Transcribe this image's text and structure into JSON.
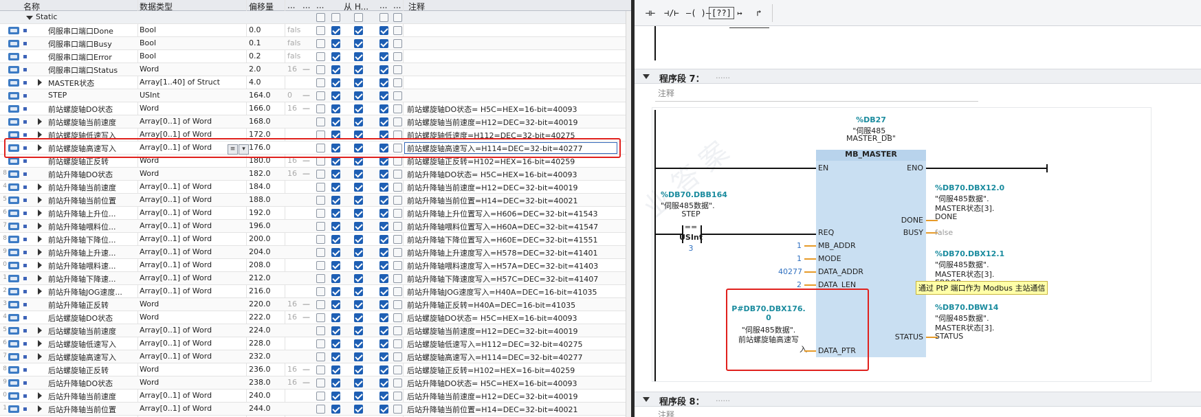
{
  "table": {
    "headers": {
      "name": "名称",
      "datatype": "数据类型",
      "offset": "偏移量",
      "col_a": "...",
      "col_b": "...",
      "col_c": "...",
      "col_d": "从 H...",
      "col_e": "...",
      "col_f": "...",
      "comment": "注释"
    },
    "static_label": "Static",
    "rows": [
      {
        "num": "",
        "name": "伺服串口端口Done",
        "type": "Bool",
        "offset": "0.0",
        "init": "fals",
        "dash": "",
        "expandable": false,
        "comment": ""
      },
      {
        "num": "",
        "name": "伺服串口端口Busy",
        "type": "Bool",
        "offset": "0.1",
        "init": "fals",
        "dash": "",
        "expandable": false,
        "comment": ""
      },
      {
        "num": "",
        "name": "伺服串口端口Error",
        "type": "Bool",
        "offset": "0.2",
        "init": "fals",
        "dash": "",
        "expandable": false,
        "comment": ""
      },
      {
        "num": "",
        "name": "伺服串口端口Status",
        "type": "Word",
        "offset": "2.0",
        "init": "16",
        "dash": "—",
        "expandable": false,
        "comment": ""
      },
      {
        "num": "",
        "name": "MASTER状态",
        "type": "Array[1..40] of Struct",
        "offset": "4.0",
        "init": "",
        "dash": "",
        "expandable": true,
        "comment": ""
      },
      {
        "num": "",
        "name": "STEP",
        "type": "USInt",
        "offset": "164.0",
        "init": "0",
        "dash": "—",
        "expandable": false,
        "comment": ""
      },
      {
        "num": "",
        "name": "前站螺旋轴DO状态",
        "type": "Word",
        "offset": "166.0",
        "init": "16",
        "dash": "—",
        "expandable": false,
        "comment": "前站螺旋轴DO状态= H5C=HEX=16-bit=40093"
      },
      {
        "num": "",
        "name": "前站螺旋轴当前速度",
        "type": "Array[0..1] of Word",
        "offset": "168.0",
        "init": "",
        "dash": "",
        "expandable": true,
        "comment": "前站螺旋轴当前速度=H12=DEC=32-bit=40019"
      },
      {
        "num": "",
        "name": "前站螺旋轴低速写入",
        "type": "Array[0..1] of Word",
        "offset": "172.0",
        "init": "",
        "dash": "",
        "expandable": true,
        "comment": "前站螺旋轴低速度=H112=DEC=32-bit=40275"
      },
      {
        "num": "",
        "name": "前站螺旋轴高速写入",
        "type": "Array[0..1] of Word",
        "offset": "176.0",
        "init": "",
        "dash": "",
        "expandable": true,
        "comment": "前站螺旋轴高速写入=H114=DEC=32-bit=40277",
        "selected": true
      },
      {
        "num": "",
        "name": "前站螺旋轴正反转",
        "type": "Word",
        "offset": "180.0",
        "init": "16",
        "dash": "—",
        "expandable": false,
        "comment": "前站螺旋轴正反转=H102=HEX=16-bit=40259"
      },
      {
        "num": "8",
        "name": "前站升降轴DO状态",
        "type": "Word",
        "offset": "182.0",
        "init": "16",
        "dash": "—",
        "expandable": false,
        "comment": "前站升降轴DO状态= H5C=HEX=16-bit=40093"
      },
      {
        "num": "4",
        "name": "前站升降轴当前速度",
        "type": "Array[0..1] of Word",
        "offset": "184.0",
        "init": "",
        "dash": "",
        "expandable": true,
        "comment": "前站升降轴当前速度=H12=DEC=32-bit=40019"
      },
      {
        "num": "5",
        "name": "前站升降轴当前位置",
        "type": "Array[0..1] of Word",
        "offset": "188.0",
        "init": "",
        "dash": "",
        "expandable": true,
        "comment": "前站升降轴当前位置=H14=DEC=32-bit=40021"
      },
      {
        "num": "6",
        "name": "前站升降轴上升位...",
        "type": "Array[0..1] of Word",
        "offset": "192.0",
        "init": "",
        "dash": "",
        "expandable": true,
        "comment": "前站升降轴上升位置写入=H606=DEC=32-bit=41543"
      },
      {
        "num": "7",
        "name": "前站升降轴喂料位...",
        "type": "Array[0..1] of Word",
        "offset": "196.0",
        "init": "",
        "dash": "",
        "expandable": true,
        "comment": "前站升降轴喂料位置写入=H60A=DEC=32-bit=41547"
      },
      {
        "num": "8",
        "name": "前站升降轴下降位...",
        "type": "Array[0..1] of Word",
        "offset": "200.0",
        "init": "",
        "dash": "",
        "expandable": true,
        "comment": "前站升降轴下降位置写入=H60E=DEC=32-bit=41551"
      },
      {
        "num": "9",
        "name": "前站升降轴上升速...",
        "type": "Array[0..1] of Word",
        "offset": "204.0",
        "init": "",
        "dash": "",
        "expandable": true,
        "comment": "前站升降轴上升速度写入=H578=DEC=32-bit=41401"
      },
      {
        "num": "0",
        "name": "前站升降轴喂料速...",
        "type": "Array[0..1] of Word",
        "offset": "208.0",
        "init": "",
        "dash": "",
        "expandable": true,
        "comment": "前站升降轴喂料速度写入=H57A=DEC=32-bit=41403"
      },
      {
        "num": "1",
        "name": "前站升降轴下降速...",
        "type": "Array[0..1] of Word",
        "offset": "212.0",
        "init": "",
        "dash": "",
        "expandable": true,
        "comment": "前站升降轴下降速度写入=H57C=DEC=32-bit=41407"
      },
      {
        "num": "2",
        "name": "前站升降轴JOG速度...",
        "type": "Array[0..1] of Word",
        "offset": "216.0",
        "init": "",
        "dash": "",
        "expandable": true,
        "comment": "前站升降轴JOG速度写入=H40A=DEC=16-bit=41035"
      },
      {
        "num": "3",
        "name": "前站升降轴正反转",
        "type": "Word",
        "offset": "220.0",
        "init": "16",
        "dash": "—",
        "expandable": false,
        "comment": "前站升降轴正反转=H40A=DEC=16-bit=41035"
      },
      {
        "num": "4",
        "name": "后站螺旋轴DO状态",
        "type": "Word",
        "offset": "222.0",
        "init": "16",
        "dash": "—",
        "expandable": false,
        "comment": "后站螺旋轴DO状态= H5C=HEX=16-bit=40093"
      },
      {
        "num": "5",
        "name": "后站螺旋轴当前速度",
        "type": "Array[0..1] of Word",
        "offset": "224.0",
        "init": "",
        "dash": "",
        "expandable": true,
        "comment": "后站螺旋轴当前速度=H12=DEC=32-bit=40019"
      },
      {
        "num": "6",
        "name": "后站螺旋轴低速写入",
        "type": "Array[0..1] of Word",
        "offset": "228.0",
        "init": "",
        "dash": "",
        "expandable": true,
        "comment": "后站螺旋轴低速写入=H112=DEC=32-bit=40275"
      },
      {
        "num": "7",
        "name": "后站螺旋轴高速写入",
        "type": "Array[0..1] of Word",
        "offset": "232.0",
        "init": "",
        "dash": "",
        "expandable": true,
        "comment": "后站螺旋轴高速写入=H114=DEC=32-bit=40277"
      },
      {
        "num": "8",
        "name": "后站螺旋轴正反转",
        "type": "Word",
        "offset": "236.0",
        "init": "16",
        "dash": "—",
        "expandable": false,
        "comment": "后站螺旋轴正反转=H102=HEX=16-bit=40259"
      },
      {
        "num": "9",
        "name": "后站升降轴DO状态",
        "type": "Word",
        "offset": "238.0",
        "init": "16",
        "dash": "—",
        "expandable": false,
        "comment": "后站升降轴DO状态= H5C=HEX=16-bit=40093"
      },
      {
        "num": "0",
        "name": "后站升降轴当前速度",
        "type": "Array[0..1] of Word",
        "offset": "240.0",
        "init": "",
        "dash": "",
        "expandable": true,
        "comment": "后站升降轴当前速度=H12=DEC=32-bit=40019"
      },
      {
        "num": "1",
        "name": "后站升降轴当前位置",
        "type": "Array[0..1] of Word",
        "offset": "244.0",
        "init": "",
        "dash": "",
        "expandable": true,
        "comment": "后站升降轴当前位置=H14=DEC=32-bit=40021"
      }
    ]
  },
  "editor": {
    "toolbar": [
      "⊣⊢",
      "⊣/⊢",
      "–( )–",
      "[??]",
      "↦",
      "↱"
    ],
    "segment7": {
      "title": "程序段 7：",
      "dots": "......",
      "comment": "注释"
    },
    "segment8": {
      "title": "程序段 8：",
      "dots": "......",
      "comment": "注释"
    },
    "block": {
      "db_name": "%DB27",
      "db_label1": "\"伺服485_",
      "db_label2": "MASTER_DB\"",
      "title": "MB_MASTER",
      "pins_left": [
        "EN",
        "REQ",
        "MB_ADDR",
        "MODE",
        "DATA_ADDR",
        "DATA_LEN",
        "DATA_PTR"
      ],
      "pins_right": [
        "ENO",
        "DONE",
        "BUSY",
        "STATUS"
      ]
    },
    "contact": {
      "addr": "%DB70.DBB164",
      "label1": "\"伺服485数据\".",
      "label2": "STEP",
      "op": "==",
      "type": "USInt",
      "value": "3"
    },
    "inputs": {
      "mb_addr": "1",
      "mode": "1",
      "data_addr": "40277",
      "data_len": "2"
    },
    "data_ptr": {
      "line1": "P#DB70.DBX176.",
      "line2": "0",
      "line3": "\"伺服485数据\".",
      "line4": "前站螺旋轴高速写",
      "line5": "入"
    },
    "done_out": {
      "addr": "%DB70.DBX12.0",
      "l1": "\"伺服485数据\".",
      "l2": "MASTER状态[3].",
      "l3": "DONE"
    },
    "busy_out": {
      "value": "false"
    },
    "status_out": {
      "addr1": "%DB70.DBX12.1",
      "a1": "\"伺服485数据\".",
      "a2": "MASTER状态[3].",
      "a3": "ERROR",
      "addr2": "%DB70.DBW14",
      "b1": "\"伺服485数据\".",
      "b2": "MASTER状态[3].",
      "b3": "STATUS"
    },
    "tooltip": "通过 PtP 端口作为 Modbus 主站通信",
    "watermark": "业 答 案"
  }
}
